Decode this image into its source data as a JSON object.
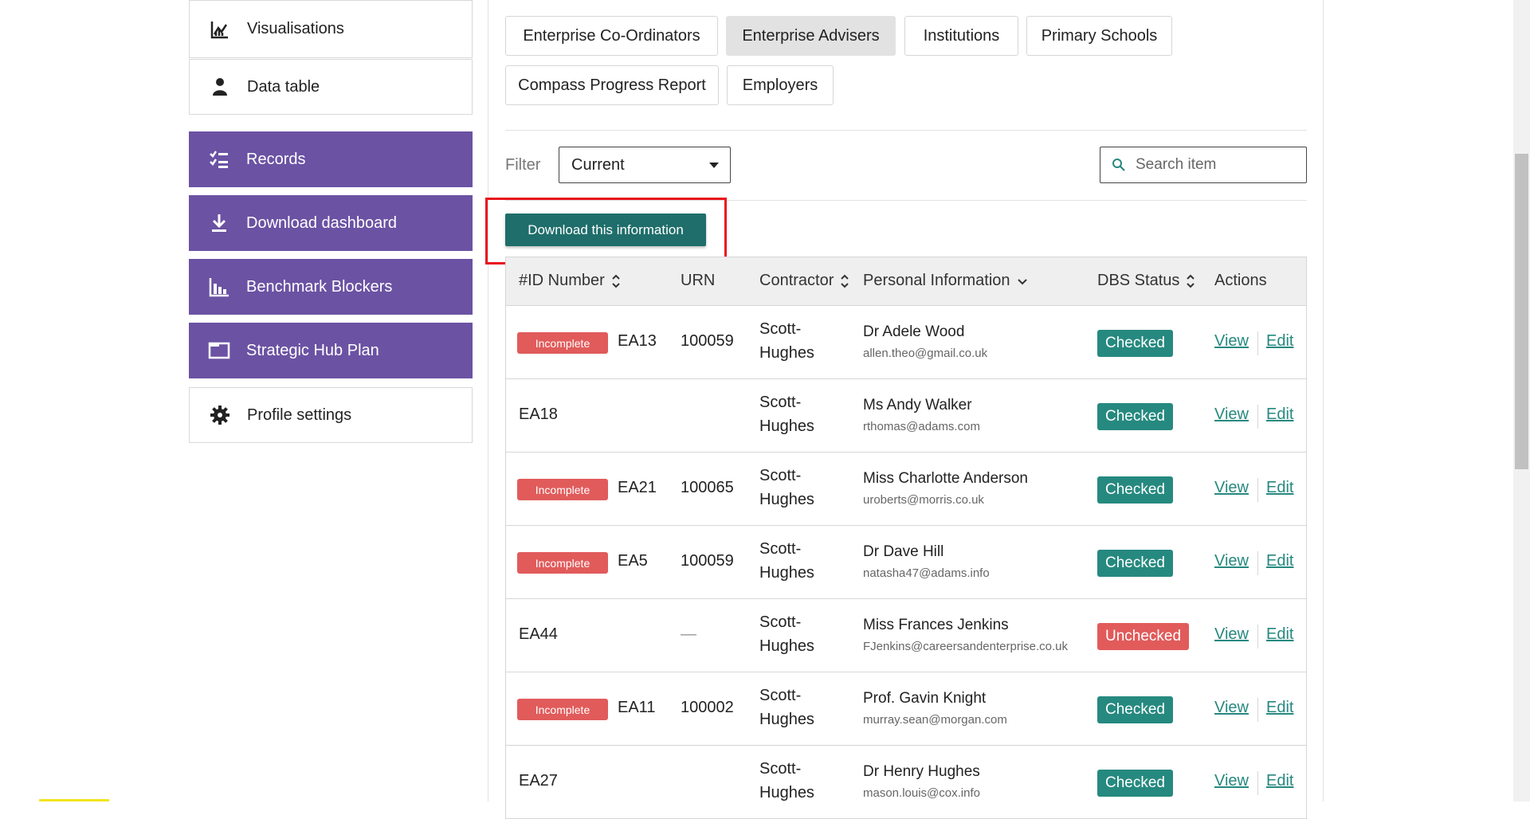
{
  "sidebar": {
    "items": [
      {
        "label": "Visualisations",
        "icon": "chart-line-icon",
        "style": "light"
      },
      {
        "label": "Data table",
        "icon": "person-icon",
        "style": "light"
      },
      {
        "label": "Records",
        "icon": "checklist-icon",
        "style": "purple"
      },
      {
        "label": "Download dashboard",
        "icon": "download-icon",
        "style": "purple"
      },
      {
        "label": "Benchmark Blockers",
        "icon": "bar-chart-icon",
        "style": "purple"
      },
      {
        "label": "Strategic Hub Plan",
        "icon": "window-icon",
        "style": "purple"
      },
      {
        "label": "Profile settings",
        "icon": "gear-icon",
        "style": "light"
      }
    ]
  },
  "tabs": [
    {
      "label": "Enterprise Co-Ordinators",
      "active": false
    },
    {
      "label": "Enterprise Advisers",
      "active": true
    },
    {
      "label": "Institutions",
      "active": false
    },
    {
      "label": "Primary Schools",
      "active": false
    },
    {
      "label": "Compass Progress Report",
      "active": false
    },
    {
      "label": "Employers",
      "active": false
    }
  ],
  "filter": {
    "label": "Filter",
    "selected": "Current"
  },
  "search": {
    "placeholder": "Search item"
  },
  "download_button": "Download this information",
  "table": {
    "headers": {
      "id": "#ID Number",
      "urn": "URN",
      "contractor": "Contractor",
      "personal": "Personal Information",
      "dbs": "DBS Status",
      "actions": "Actions"
    },
    "rows": [
      {
        "incomplete": "Incomplete",
        "id": "EA13",
        "urn": "100059",
        "contractor1": "Scott-",
        "contractor2": "Hughes",
        "name": "Dr Adele Wood",
        "email": "allen.theo@gmail.co.uk",
        "dbs": "Checked",
        "view": "View",
        "edit": "Edit"
      },
      {
        "incomplete": "",
        "id": "EA18",
        "urn": "",
        "contractor1": "Scott-",
        "contractor2": "Hughes",
        "name": "Ms Andy Walker",
        "email": "rthomas@adams.com",
        "dbs": "Checked",
        "view": "View",
        "edit": "Edit"
      },
      {
        "incomplete": "Incomplete",
        "id": "EA21",
        "urn": "100065",
        "contractor1": "Scott-",
        "contractor2": "Hughes",
        "name": "Miss Charlotte Anderson",
        "email": "uroberts@morris.co.uk",
        "dbs": "Checked",
        "view": "View",
        "edit": "Edit"
      },
      {
        "incomplete": "Incomplete",
        "id": "EA5",
        "urn": "100059",
        "contractor1": "Scott-",
        "contractor2": "Hughes",
        "name": "Dr Dave Hill",
        "email": "natasha47@adams.info",
        "dbs": "Checked",
        "view": "View",
        "edit": "Edit"
      },
      {
        "incomplete": "",
        "id": "EA44",
        "urn": "—",
        "contractor1": "Scott-",
        "contractor2": "Hughes",
        "name": "Miss Frances Jenkins",
        "email": "FJenkins@careersandenterprise.co.uk",
        "dbs": "Unchecked",
        "view": "View",
        "edit": "Edit"
      },
      {
        "incomplete": "Incomplete",
        "id": "EA11",
        "urn": "100002",
        "contractor1": "Scott-",
        "contractor2": "Hughes",
        "name": "Prof. Gavin Knight",
        "email": "murray.sean@morgan.com",
        "dbs": "Checked",
        "view": "View",
        "edit": "Edit"
      },
      {
        "incomplete": "",
        "id": "EA27",
        "urn": "",
        "contractor1": "Scott-",
        "contractor2": "Hughes",
        "name": "Dr Henry Hughes",
        "email": "mason.louis@cox.info",
        "dbs": "Checked",
        "view": "View",
        "edit": "Edit"
      }
    ]
  },
  "colors": {
    "purple": "#6b52a3",
    "teal": "#26897f",
    "red": "#e15b5b",
    "highlight": "#e8141d"
  }
}
